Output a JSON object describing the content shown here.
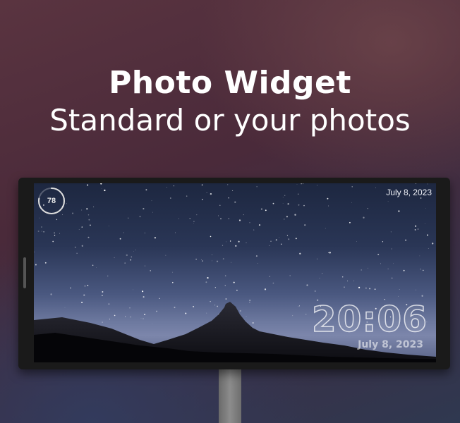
{
  "promo": {
    "title": "Photo Widget",
    "subtitle": "Standard or your photos"
  },
  "widget": {
    "battery_level": "78",
    "battery_fraction": 0.78,
    "top_date": "July 8, 2023",
    "clock_time": "20:06",
    "clock_date": "July 8, 2023"
  },
  "colors": {
    "text": "#ffffff",
    "ring": "#dddddd"
  }
}
